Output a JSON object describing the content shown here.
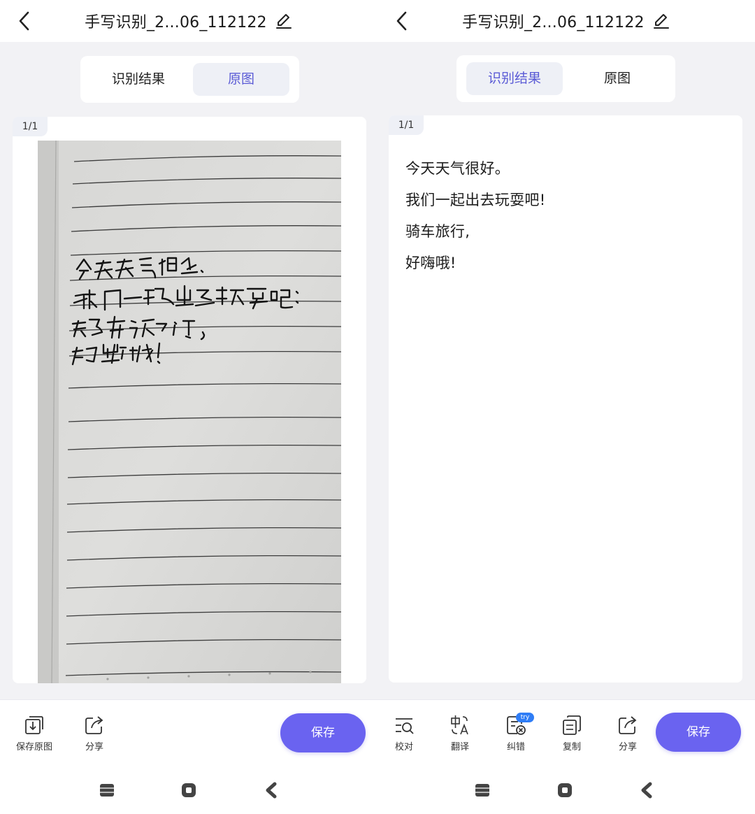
{
  "left": {
    "header": {
      "title": "手写识别_2...06_112122"
    },
    "tabs": [
      {
        "label": "识别结果",
        "active": false
      },
      {
        "label": "原图",
        "active": true
      }
    ],
    "page_indicator": "1/1",
    "bottom": {
      "save_original_label": "保存原图",
      "share_label": "分享",
      "save_label": "保存"
    }
  },
  "right": {
    "header": {
      "title": "手写识别_2...06_112122"
    },
    "tabs": [
      {
        "label": "识别结果",
        "active": true
      },
      {
        "label": "原图",
        "active": false
      }
    ],
    "page_indicator": "1/1",
    "recognized_lines": [
      "今天天气很好。",
      "我们一起出去玩耍吧!",
      "骑车旅行,",
      "好嗨哦!"
    ],
    "bottom": {
      "proofread_label": "校对",
      "translate_label": "翻译",
      "correct_label": "纠错",
      "correct_badge": "try",
      "copy_label": "复制",
      "share_label": "分享",
      "save_label": "保存"
    }
  },
  "colors": {
    "accent": "#6a63f0",
    "active_tab_text": "#5b5bd6",
    "active_tab_bg": "#eef0f6",
    "page_bg": "#f2f2f5",
    "try_badge": "#2f7df6"
  },
  "icons": [
    "back-arrow-icon",
    "edit-pencil-icon",
    "save-original-icon",
    "share-icon",
    "proofread-icon",
    "translate-icon",
    "correct-icon",
    "copy-icon",
    "nav-recents-icon",
    "nav-home-icon",
    "nav-back-icon"
  ]
}
